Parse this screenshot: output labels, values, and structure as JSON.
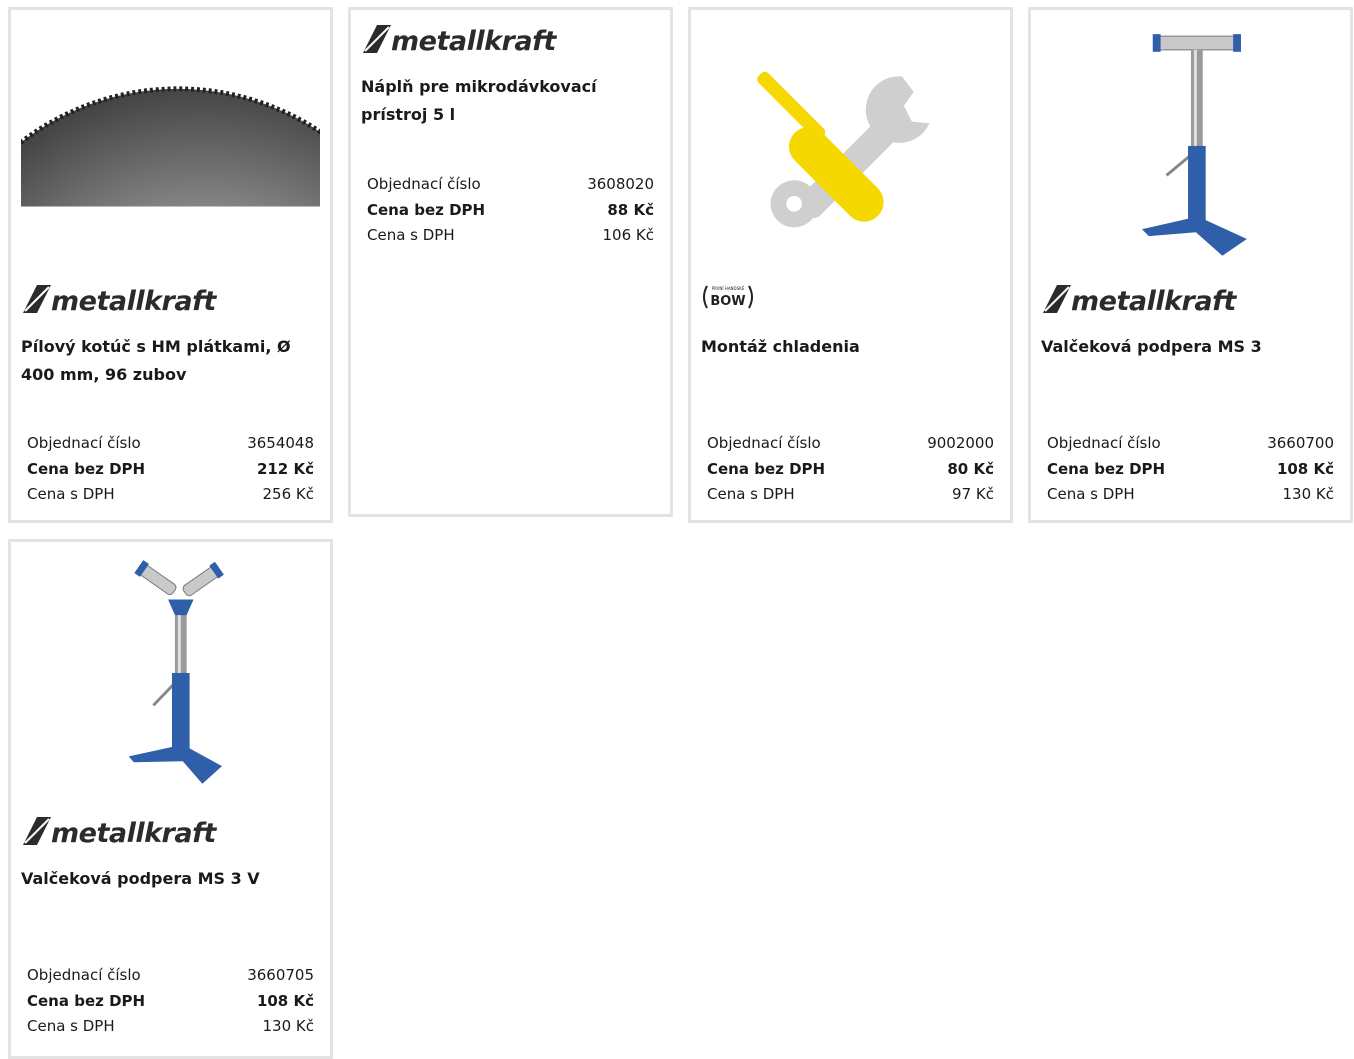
{
  "brand": {
    "metallkraft": "metallkraft",
    "bow": "BOW",
    "bow_small": "PRVNÍ HANDSKÉ"
  },
  "labels": {
    "order_no": "Objednací číslo",
    "price_ex": "Cena bez DPH",
    "price_inc": "Cena s DPH"
  },
  "products": [
    {
      "title": "Pílový kotúč s HM plátkami, Ø 400 mm, 96 zubov",
      "order_no": "3654048",
      "price_ex": "212 Kč",
      "price_inc": "256 Kč",
      "brand": "metallkraft",
      "image": "saw-blade"
    },
    {
      "title": "Náplň pre mikrodávkovací prístroj 5 l",
      "order_no": "3608020",
      "price_ex": "88 Kč",
      "price_inc": "106 Kč",
      "brand": "metallkraft",
      "image": "none"
    },
    {
      "title": "Montáž chladenia",
      "order_no": "9002000",
      "price_ex": "80 Kč",
      "price_inc": "97 Kč",
      "brand": "bow",
      "image": "tools"
    },
    {
      "title": "Valčeková podpera MS 3",
      "order_no": "3660700",
      "price_ex": "108 Kč",
      "price_inc": "130 Kč",
      "brand": "metallkraft",
      "image": "roller-stand"
    },
    {
      "title": "Valčeková podpera MS 3 V",
      "order_no": "3660705",
      "price_ex": "108 Kč",
      "price_inc": "130 Kč",
      "brand": "metallkraft",
      "image": "v-roller-stand"
    }
  ],
  "colors": {
    "border": "#e3e3e3",
    "stand_blue": "#2f5fa8",
    "tool_yellow": "#f5d800",
    "tool_grey": "#cfcfcf"
  }
}
